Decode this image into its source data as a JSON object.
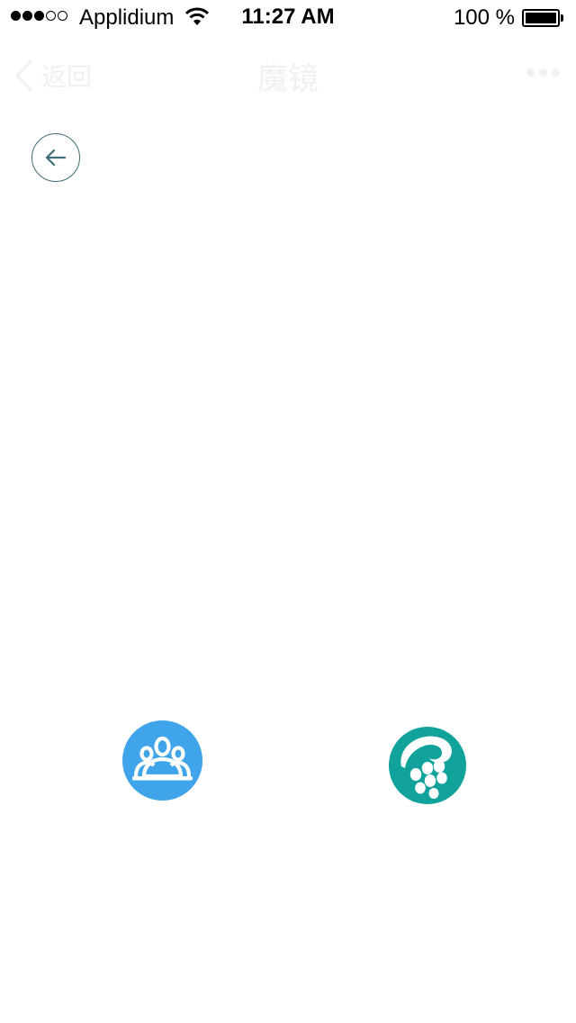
{
  "status_bar": {
    "signal_strength": 3,
    "signal_max": 5,
    "carrier": "Applidium",
    "wifi_icon": "wifi-icon",
    "time": "11:27 AM",
    "battery_text": "100 %",
    "battery_level": 1.0
  },
  "nav_bar": {
    "back_icon": "chevron-left-icon",
    "back_label": "返回",
    "title": "魔镜",
    "more_icon": "more-dots-icon"
  },
  "circle_back": {
    "icon": "arrow-left-icon"
  },
  "apps": [
    {
      "icon": "group-people-icon"
    },
    {
      "icon": "grape-logo-icon"
    }
  ],
  "colors": {
    "group_app_bg": "#3fa4e9",
    "grape_app_bg": "#11a39b",
    "circle_back_stroke": "#3e6f78",
    "nav_faint": "#f0f0f0"
  }
}
